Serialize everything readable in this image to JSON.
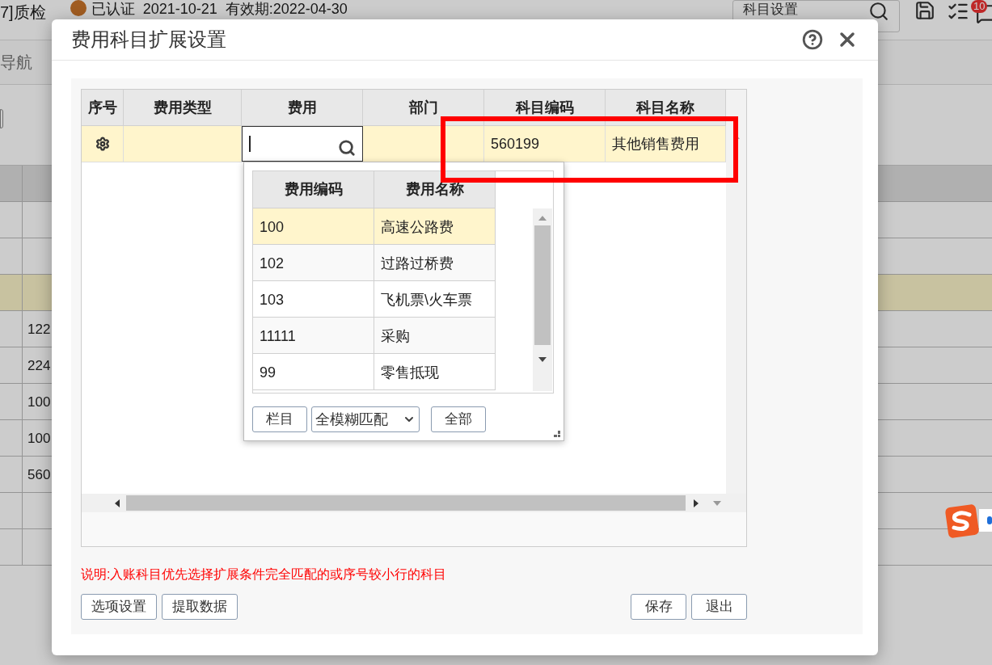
{
  "background_page": {
    "header_left": "7]质检",
    "cert_text": "已认证  2021-10-21  有效期:2022-04-30",
    "search_field": {
      "value": "科目设置"
    },
    "badge": "10",
    "nav_label": "导航",
    "rows": [
      {
        "value": "",
        "selected": false
      },
      {
        "value": "",
        "selected": false
      },
      {
        "value": "",
        "selected": true
      },
      {
        "value": "122",
        "selected": false
      },
      {
        "value": "224",
        "selected": false
      },
      {
        "value": "100",
        "selected": false
      },
      {
        "value": "100",
        "selected": false
      },
      {
        "value": "560",
        "selected": false
      },
      {
        "value": "",
        "selected": false
      },
      {
        "value": "",
        "selected": false
      }
    ]
  },
  "dialog": {
    "title": "费用科目扩展设置",
    "table": {
      "columns": [
        "序号",
        "费用类型",
        "费用",
        "部门",
        "科目编码",
        "科目名称"
      ],
      "rows": [
        {
          "selected": true,
          "expense_type": "",
          "expense": "",
          "department": "",
          "account_code": "560199",
          "account_name": "其他销售费用"
        }
      ]
    },
    "lookup": {
      "columns": [
        "费用编码",
        "费用名称"
      ],
      "rows": [
        {
          "code": "100",
          "name": "高速公路费",
          "selected": true
        },
        {
          "code": "102",
          "name": "过路过桥费",
          "selected": false
        },
        {
          "code": "103",
          "name": "飞机票\\火车票",
          "selected": false
        },
        {
          "code": "11111",
          "name": "采购",
          "selected": false
        },
        {
          "code": "99",
          "name": "零售抵现",
          "selected": false
        }
      ],
      "columns_button": "栏目",
      "match_mode": "全模糊匹配",
      "all_button": "全部"
    },
    "note": "说明:入账科目优先选择扩展条件完全匹配的或序号较小行的科目",
    "left_buttons": [
      "选项设置",
      "提取数据"
    ],
    "right_buttons": [
      "保存",
      "退出"
    ]
  }
}
